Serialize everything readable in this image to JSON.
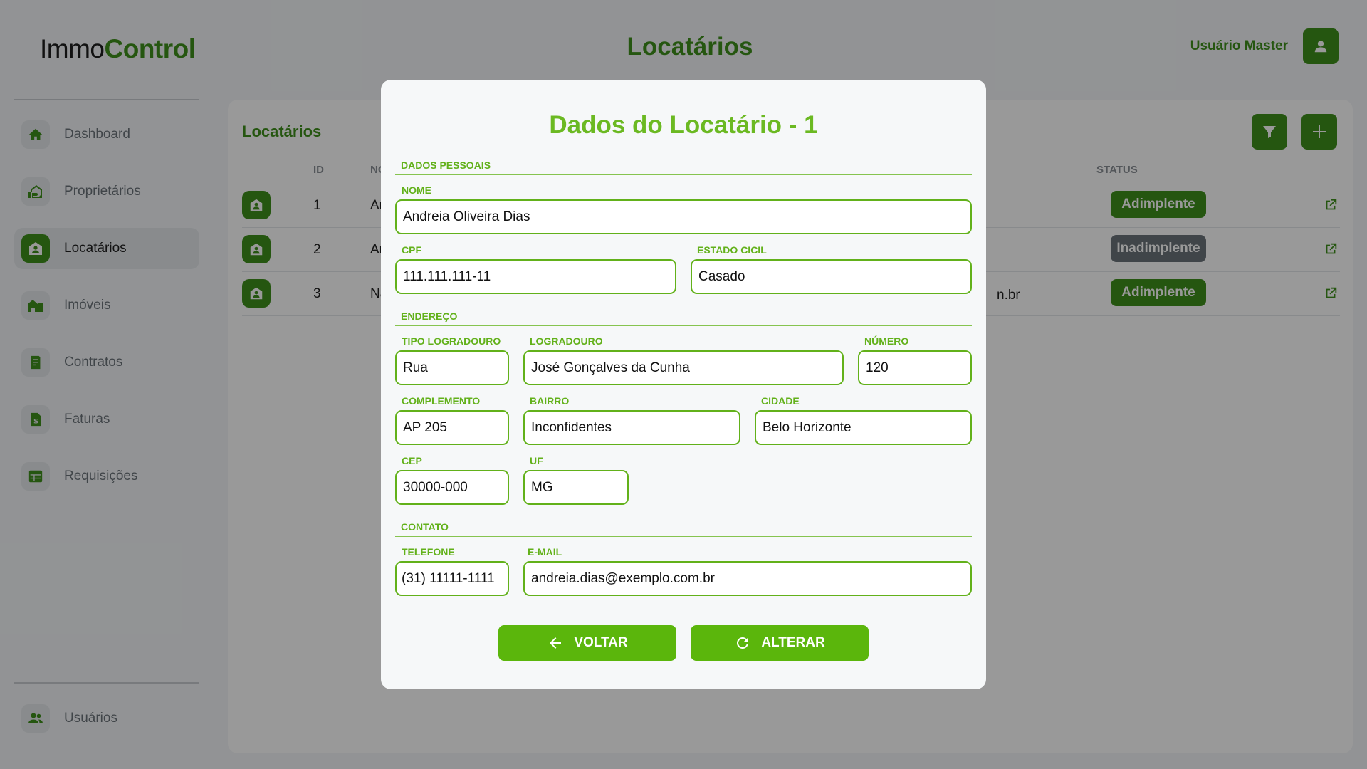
{
  "brand": {
    "part1": "Immo",
    "part2": "Control"
  },
  "header": {
    "title": "Locatários",
    "user_name": "Usuário Master"
  },
  "sidebar": {
    "items": [
      {
        "label": "Dashboard",
        "icon": "home-icon"
      },
      {
        "label": "Proprietários",
        "icon": "owner-house-icon"
      },
      {
        "label": "Locatários",
        "icon": "tenant-house-icon",
        "active": true
      },
      {
        "label": "Imóveis",
        "icon": "buildings-icon"
      },
      {
        "label": "Contratos",
        "icon": "contract-icon"
      },
      {
        "label": "Faturas",
        "icon": "invoice-icon"
      },
      {
        "label": "Requisições",
        "icon": "table-icon"
      }
    ],
    "bottom_item": {
      "label": "Usuários",
      "icon": "users-icon"
    }
  },
  "panel": {
    "title": "Locatários",
    "columns": {
      "id": "ID",
      "name": "NO",
      "status": "STATUS"
    },
    "rows": [
      {
        "id": "1",
        "name": "An",
        "email": "",
        "status": "Adimplente"
      },
      {
        "id": "2",
        "name": "An",
        "email": "",
        "status": "Inadimplente"
      },
      {
        "id": "3",
        "name": "Na",
        "email": "n.br",
        "status": "Adimplente"
      }
    ]
  },
  "modal": {
    "title": "Dados do Locatário - 1",
    "sections": {
      "personal": "DADOS PESSOAIS",
      "address": "ENDEREÇO",
      "contact": "CONTATO"
    },
    "fields": {
      "nome": {
        "label": "NOME",
        "value": "Andreia Oliveira Dias"
      },
      "cpf": {
        "label": "CPF",
        "value": "111.111.111-11"
      },
      "estado_civil": {
        "label": "ESTADO CICIL",
        "value": "Casado"
      },
      "tipo_logradouro": {
        "label": "TIPO LOGRADOURO",
        "value": "Rua"
      },
      "logradouro": {
        "label": "LOGRADOURO",
        "value": "José Gonçalves da Cunha"
      },
      "numero": {
        "label": "NÚMERO",
        "value": "120"
      },
      "complemento": {
        "label": "COMPLEMENTO",
        "value": "AP 205"
      },
      "bairro": {
        "label": "BAIRRO",
        "value": "Inconfidentes"
      },
      "cidade": {
        "label": "CIDADE",
        "value": "Belo Horizonte"
      },
      "cep": {
        "label": "CEP",
        "value": "30000-000"
      },
      "uf": {
        "label": "UF",
        "value": "MG"
      },
      "telefone": {
        "label": "TELEFONE",
        "value": "(31) 11111-1111"
      },
      "email": {
        "label": "E-MAIL",
        "value": "andreia.dias@exemplo.com.br"
      }
    },
    "buttons": {
      "back": "VOLTAR",
      "update": "ALTERAR"
    }
  },
  "colors": {
    "primary": "#3f8f1c",
    "accent": "#62b11a",
    "button": "#5bb60c",
    "status_ok": "#3f8f1c",
    "status_bad": "#6c737a"
  }
}
